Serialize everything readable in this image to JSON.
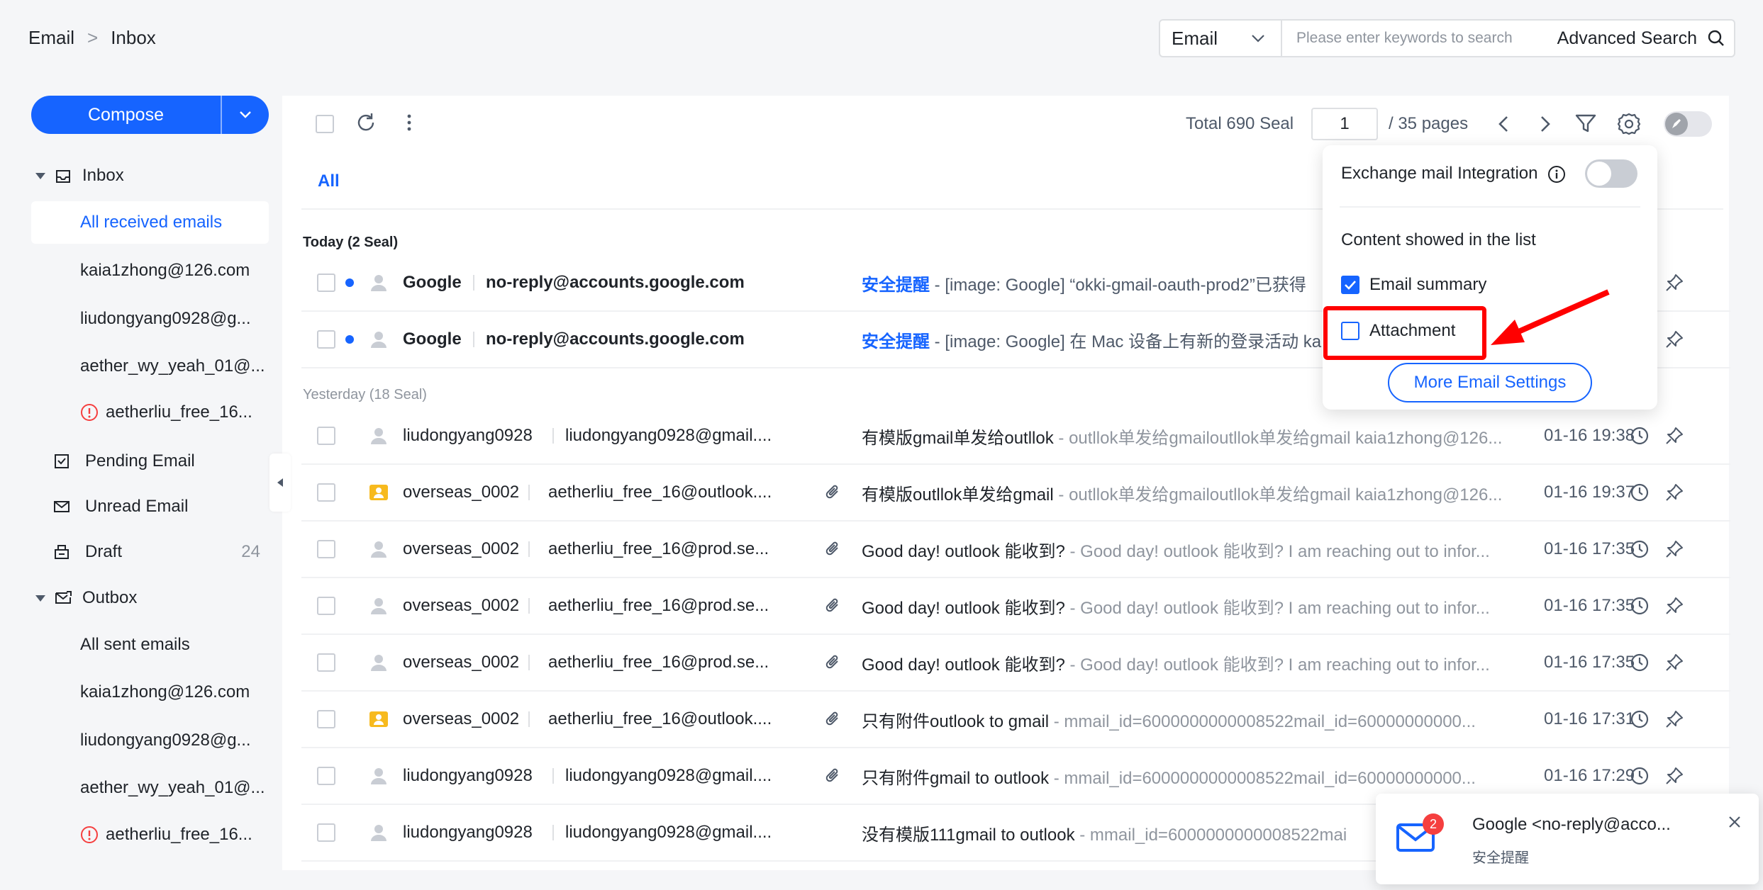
{
  "breadcrumb": {
    "root": "Email",
    "sep": ">",
    "current": "Inbox"
  },
  "search": {
    "type": "Email",
    "placeholder": "Please enter keywords to search",
    "advanced": "Advanced Search"
  },
  "compose": {
    "label": "Compose"
  },
  "sidebar": {
    "inbox_label": "Inbox",
    "inbox_items": [
      {
        "label": "All received emails"
      },
      {
        "label": "kaia1zhong@126.com"
      },
      {
        "label": "liudongyang0928@g..."
      },
      {
        "label": "aether_wy_yeah_01@..."
      },
      {
        "label": "aetherliu_free_16..."
      }
    ],
    "pending": "Pending Email",
    "unread": "Unread Email",
    "draft": "Draft",
    "draft_count": "24",
    "outbox_label": "Outbox",
    "outbox_items": [
      {
        "label": "All sent emails"
      },
      {
        "label": "kaia1zhong@126.com"
      },
      {
        "label": "liudongyang0928@g..."
      },
      {
        "label": "aether_wy_yeah_01@..."
      },
      {
        "label": "aetherliu_free_16..."
      }
    ]
  },
  "toolbar": {
    "total": "Total 690 Seal",
    "page": "1",
    "pages": "/ 35  pages"
  },
  "tabs": {
    "all": "All"
  },
  "groups": {
    "today": "Today (2 Seal)",
    "yesterday": "Yesterday (18 Seal)"
  },
  "emails": [
    {
      "sender": "Google",
      "email": "no-reply@accounts.google.com",
      "tag": "安全提醒",
      "subject": "",
      "summary": " - [image: Google] “okki-gmail-oauth-prod2”已获得",
      "time": "",
      "unread": true,
      "attach": false
    },
    {
      "sender": "Google",
      "email": "no-reply@accounts.google.com",
      "tag": "安全提醒",
      "subject": "",
      "summary": " - [image: Google] 在 Mac 设备上有新的登录活动 ka",
      "time": "",
      "unread": true,
      "attach": false
    },
    {
      "sender": "liudongyang0928",
      "email": "liudongyang0928@gmail....",
      "tag": "",
      "subject": "有模版gmail单发给outllok",
      "summary": " - outllok单发给gmailoutllok单发给gmail kaia1zhong@126...",
      "time": "01-16 19:38",
      "unread": false,
      "attach": false
    },
    {
      "sender": "overseas_0002",
      "email": "aetherliu_free_16@outlook....",
      "tag": "",
      "subject": "有模版outllok单发给gmail",
      "summary": " - outllok单发给gmailoutllok单发给gmail kaia1zhong@126...",
      "time": "01-16 19:37",
      "unread": false,
      "attach": true
    },
    {
      "sender": "overseas_0002",
      "email": "aetherliu_free_16@prod.se...",
      "tag": "",
      "subject": "Good day! outlook 能收到?",
      "summary": "  - Good day! outlook 能收到?  I am reaching out to infor...",
      "time": "01-16 17:35",
      "unread": false,
      "attach": true
    },
    {
      "sender": "overseas_0002",
      "email": "aetherliu_free_16@prod.se...",
      "tag": "",
      "subject": "Good day! outlook 能收到?",
      "summary": "  - Good day! outlook 能收到?  I am reaching out to infor...",
      "time": "01-16 17:35",
      "unread": false,
      "attach": true
    },
    {
      "sender": "overseas_0002",
      "email": "aetherliu_free_16@prod.se...",
      "tag": "",
      "subject": "Good day! outlook 能收到?",
      "summary": "  - Good day! outlook 能收到?  I am reaching out to infor...",
      "time": "01-16 17:35",
      "unread": false,
      "attach": true
    },
    {
      "sender": "overseas_0002",
      "email": "aetherliu_free_16@outlook....",
      "tag": "",
      "subject": "只有附件outlook to gmail",
      "summary": " - mmail_id=6000000000008522mail_id=60000000000...",
      "time": "01-16 17:31",
      "unread": false,
      "attach": true
    },
    {
      "sender": "liudongyang0928",
      "email": "liudongyang0928@gmail....",
      "tag": "",
      "subject": "只有附件gmail to outlook",
      "summary": " - mmail_id=6000000000008522mail_id=60000000000...",
      "time": "01-16 17:29",
      "unread": false,
      "attach": true
    },
    {
      "sender": "liudongyang0928",
      "email": "liudongyang0928@gmail....",
      "tag": "",
      "subject": "没有模版111gmail to outlook",
      "summary": " - mmail_id=6000000000008522mai",
      "time": "",
      "unread": false,
      "attach": false
    }
  ],
  "popover": {
    "exchange": "Exchange mail Integration",
    "content_title": "Content showed in the list",
    "summary": "Email summary",
    "attachment": "Attachment",
    "more": "More Email Settings"
  },
  "notification": {
    "from": "Google <no-reply@acco...",
    "subject": "安全提醒",
    "badge": "2"
  },
  "colors": {
    "accent": "#1664ff",
    "highlight": "#ff0000",
    "badge": "#f53f3f"
  }
}
